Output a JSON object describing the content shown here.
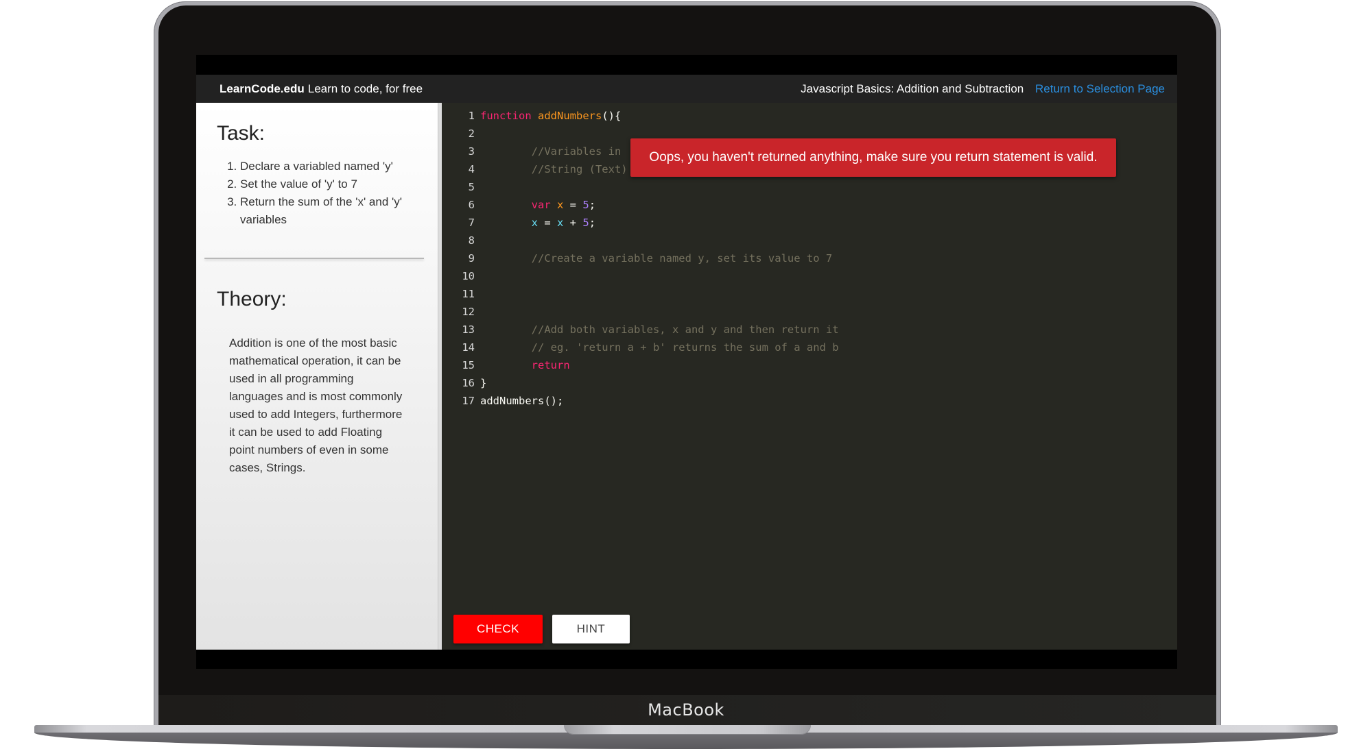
{
  "device": {
    "label": "MacBook"
  },
  "header": {
    "brand": "LearnCode.edu",
    "tagline": "Learn to code, for free",
    "lesson_title": "Javascript Basics: Addition and Subtraction",
    "return_link": "Return to Selection Page"
  },
  "task": {
    "title": "Task:",
    "items": [
      "Declare a variabled named 'y'",
      "Set the value of 'y' to 7",
      "Return the sum of the 'x' and 'y' variables"
    ]
  },
  "theory": {
    "title": "Theory:",
    "text": "Addition is one of the most basic mathematical operation, it can be used in all programming languages and is most commonly used to add Integers, furthermore it can be used to add Floating point numbers of even in some cases, Strings."
  },
  "editor": {
    "lines": [
      {
        "n": "1",
        "tokens": [
          [
            "keyword",
            "function"
          ],
          [
            "plain",
            " "
          ],
          [
            "fn",
            "addNumbers"
          ],
          [
            "plain",
            "(){"
          ]
        ]
      },
      {
        "n": "2",
        "tokens": []
      },
      {
        "n": "3",
        "tokens": [
          [
            "plain",
            "        "
          ],
          [
            "comment",
            "//Variables in"
          ]
        ]
      },
      {
        "n": "4",
        "tokens": [
          [
            "plain",
            "        "
          ],
          [
            "comment",
            "//String (Text)"
          ]
        ]
      },
      {
        "n": "5",
        "tokens": []
      },
      {
        "n": "6",
        "tokens": [
          [
            "plain",
            "        "
          ],
          [
            "keyword",
            "var"
          ],
          [
            "plain",
            " "
          ],
          [
            "orange",
            "x"
          ],
          [
            "plain",
            " = "
          ],
          [
            "num",
            "5"
          ],
          [
            "plain",
            ";"
          ]
        ]
      },
      {
        "n": "7",
        "tokens": [
          [
            "plain",
            "        "
          ],
          [
            "var",
            "x"
          ],
          [
            "plain",
            " = "
          ],
          [
            "var",
            "x"
          ],
          [
            "plain",
            " + "
          ],
          [
            "num",
            "5"
          ],
          [
            "plain",
            ";"
          ]
        ]
      },
      {
        "n": "8",
        "tokens": []
      },
      {
        "n": "9",
        "tokens": [
          [
            "plain",
            "        "
          ],
          [
            "comment",
            "//Create a variable named y, set its value to 7"
          ]
        ]
      },
      {
        "n": "10",
        "tokens": []
      },
      {
        "n": "11",
        "tokens": []
      },
      {
        "n": "12",
        "tokens": []
      },
      {
        "n": "13",
        "tokens": [
          [
            "plain",
            "        "
          ],
          [
            "comment",
            "//Add both variables, x and y and then return it"
          ]
        ]
      },
      {
        "n": "14",
        "tokens": [
          [
            "plain",
            "        "
          ],
          [
            "comment",
            "// eg. 'return a + b' returns the sum of a and b"
          ]
        ]
      },
      {
        "n": "15",
        "tokens": [
          [
            "plain",
            "        "
          ],
          [
            "keyword",
            "return"
          ]
        ]
      },
      {
        "n": "16",
        "tokens": [
          [
            "plain",
            "}"
          ]
        ]
      },
      {
        "n": "17",
        "tokens": [
          [
            "plain",
            "addNumbers();"
          ]
        ]
      }
    ]
  },
  "error": {
    "message": "Oops, you haven't returned anything, make sure you return statement is valid."
  },
  "buttons": {
    "check": "CHECK",
    "hint": "HINT"
  },
  "colors": {
    "check": "#ff0000",
    "error": "#c9252a",
    "link": "#2a8fe0",
    "editor_bg": "#272822"
  }
}
